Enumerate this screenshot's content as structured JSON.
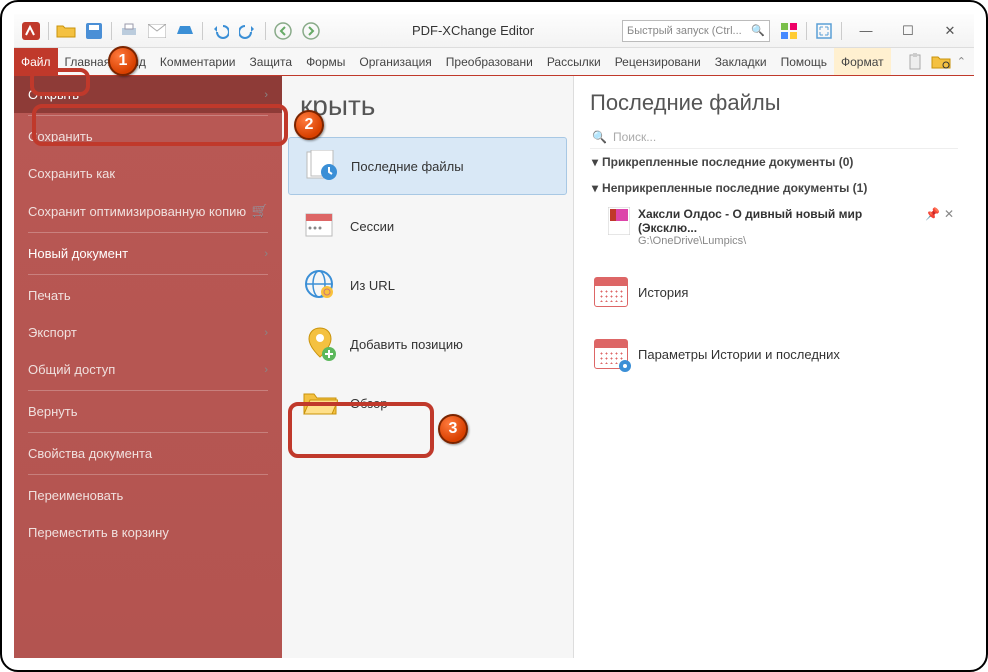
{
  "titlebar": {
    "title": "PDF-XChange Editor",
    "search_placeholder": "Быстрый запуск (Ctrl..."
  },
  "ribbon": {
    "tabs": [
      "Файл",
      "Главная",
      "Вид",
      "Комментарии",
      "Защита",
      "Формы",
      "Организация",
      "Преобразовани",
      "Рассылки",
      "Рецензировани",
      "Закладки",
      "Помощь"
    ],
    "format": "Формат"
  },
  "file_menu": {
    "open": "Открыть",
    "save": "Сохранить",
    "save_as": "Сохранить как",
    "save_optimized": "Сохранит оптимизированную копию",
    "new_doc": "Новый документ",
    "print": "Печать",
    "export": "Экспорт",
    "share": "Общий доступ",
    "revert": "Вернуть",
    "props": "Свойства документа",
    "rename": "Переименовать",
    "recycle": "Переместить в корзину"
  },
  "open_panel": {
    "title": "крыть",
    "recent": "Последние файлы",
    "sessions": "Сессии",
    "from_url": "Из URL",
    "add_place": "Добавить позицию",
    "browse": "Обзор"
  },
  "right": {
    "title": "Последние файлы",
    "search": "Поиск...",
    "pinned": "Прикрепленные последние документы (0)",
    "unpinned": "Неприкрепленные последние документы (1)",
    "file_name": "Хаксли Олдос - О дивный новый мир (Эксклю...",
    "file_path": "G:\\OneDrive\\Lumpics\\",
    "history": "История",
    "history_params": "Параметры Истории и последних"
  },
  "markers": {
    "m1": "1",
    "m2": "2",
    "m3": "3"
  }
}
